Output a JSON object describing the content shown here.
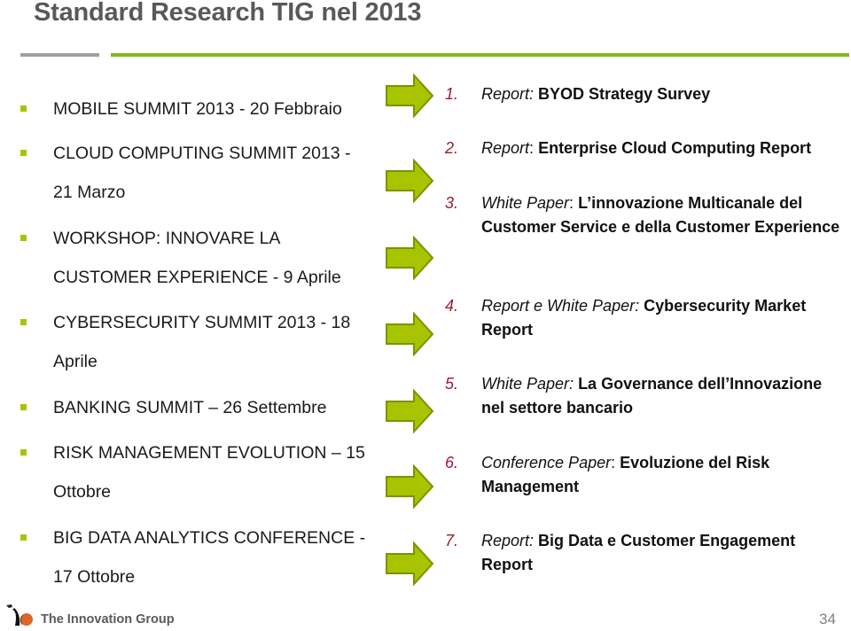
{
  "title": "Standard Research TIG nel 2013",
  "colors": {
    "title": "#595959",
    "accent_green": "#84b81d",
    "arrow_fill": "#a8c400",
    "arrow_border": "#7a9400",
    "number_red": "#9b1b30",
    "rule_gray": "#a0a0a0"
  },
  "events": [
    {
      "lines": [
        "MOBILE SUMMIT 2013 - 20 Febbraio"
      ]
    },
    {
      "lines": [
        "CLOUD COMPUTING SUMMIT 2013 -",
        "21 Marzo"
      ]
    },
    {
      "lines": [
        "WORKSHOP: INNOVARE LA",
        "CUSTOMER EXPERIENCE - 9 Aprile"
      ]
    },
    {
      "lines": [
        "CYBERSECURITY SUMMIT 2013 - 18",
        "Aprile"
      ]
    },
    {
      "lines": [
        "BANKING SUMMIT – 26 Settembre"
      ]
    },
    {
      "lines": [
        "RISK MANAGEMENT EVOLUTION – 15",
        "Ottobre"
      ]
    },
    {
      "lines": [
        "BIG DATA  ANALYTICS  CONFERENCE -",
        "17 Ottobre"
      ]
    }
  ],
  "arrow_icon": "right-arrow-icon",
  "reports": [
    {
      "number": "1.",
      "kind": "Report:",
      "name": "BYOD Strategy Survey"
    },
    {
      "number": "2.",
      "kind": "Report",
      "sep": ":",
      "name": "Enterprise Cloud Computing Report"
    },
    {
      "number": "3.",
      "kind": "White Paper",
      "sep": ":",
      "name": "L’innovazione Multicanale del Customer Service e della Customer Experience"
    },
    {
      "number": "4.",
      "kind": "Report e White Paper:",
      "name": "Cybersecurity Market Report"
    },
    {
      "number": "5.",
      "kind": "White Paper:",
      "name": " La Governance dell’Innovazione nel settore bancario"
    },
    {
      "number": "6.",
      "kind": "Conference Paper",
      "sep": ":",
      "name": "Evoluzione del Risk Management"
    },
    {
      "number": "7.",
      "kind": "Report:",
      "name": "Big Data e Customer Engagement Report"
    }
  ],
  "footer": {
    "brand": "The Innovation Group",
    "page_number": "34"
  }
}
